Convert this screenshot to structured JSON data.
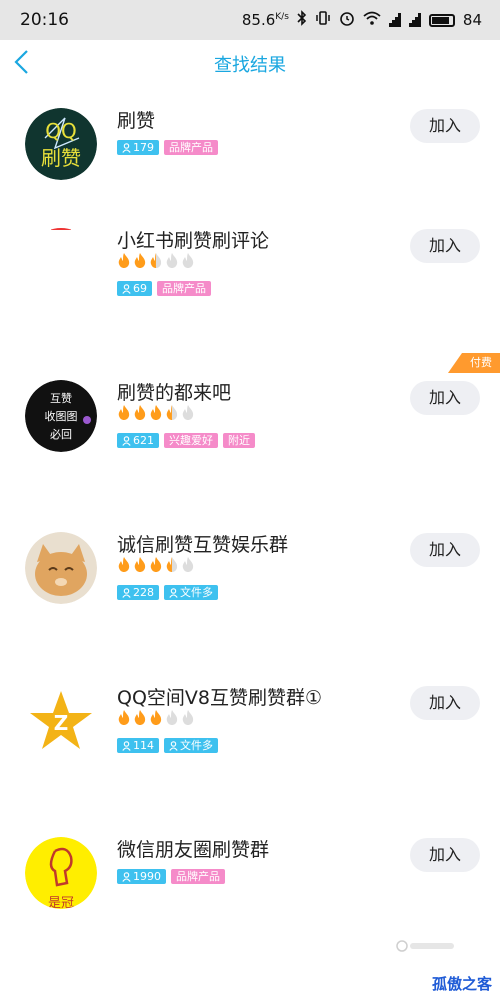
{
  "status_bar": {
    "time": "20:16",
    "speed": "85.6",
    "speed_unit": "K/s",
    "battery": "84"
  },
  "nav": {
    "title": "查找结果",
    "back_icon": "chevron-left-icon"
  },
  "colors": {
    "accent": "#1aa7e0",
    "tag_blue": "#3ec1ef",
    "tag_pink": "#f58bc9",
    "flame_on": "#ff9c1a",
    "flame_off": "#dddddd",
    "paid": "#ff9a2e"
  },
  "results": [
    {
      "name": "刷赞",
      "level": null,
      "members": "179",
      "tags": [
        "品牌产品"
      ],
      "tag_colors": [
        "pink"
      ],
      "join": "加入",
      "paid": null,
      "avatar_text": "QQ刷赞"
    },
    {
      "name": "小红书刷赞刷评论",
      "level": 2.5,
      "members": "69",
      "tags": [
        "品牌产品"
      ],
      "tag_colors": [
        "pink"
      ],
      "join": "加入",
      "paid": null,
      "avatar_text": ""
    },
    {
      "name": "刷赞的都来吧",
      "level": 3.5,
      "members": "621",
      "tags": [
        "兴趣爱好",
        "附近"
      ],
      "tag_colors": [
        "pink",
        "pink"
      ],
      "join": "加入",
      "paid": "付费",
      "avatar_text": "互赞 收图图 必回"
    },
    {
      "name": "诚信刷赞互赞娱乐群",
      "level": 3.5,
      "members": "228",
      "tags": [
        "文件多"
      ],
      "tag_colors": [
        "blue"
      ],
      "join": "加入",
      "paid": null,
      "avatar_text": ""
    },
    {
      "name": "QQ空间V8互赞刷赞群①",
      "level": 3,
      "members": "114",
      "tags": [
        "文件多"
      ],
      "tag_colors": [
        "blue"
      ],
      "join": "加入",
      "paid": null,
      "avatar_text": ""
    },
    {
      "name": "微信朋友圈刷赞群",
      "level": null,
      "members": "1990",
      "tags": [
        "品牌产品"
      ],
      "tag_colors": [
        "pink"
      ],
      "join": "加入",
      "paid": null,
      "avatar_text": "是冠"
    }
  ],
  "watermark": "孤傲之客"
}
